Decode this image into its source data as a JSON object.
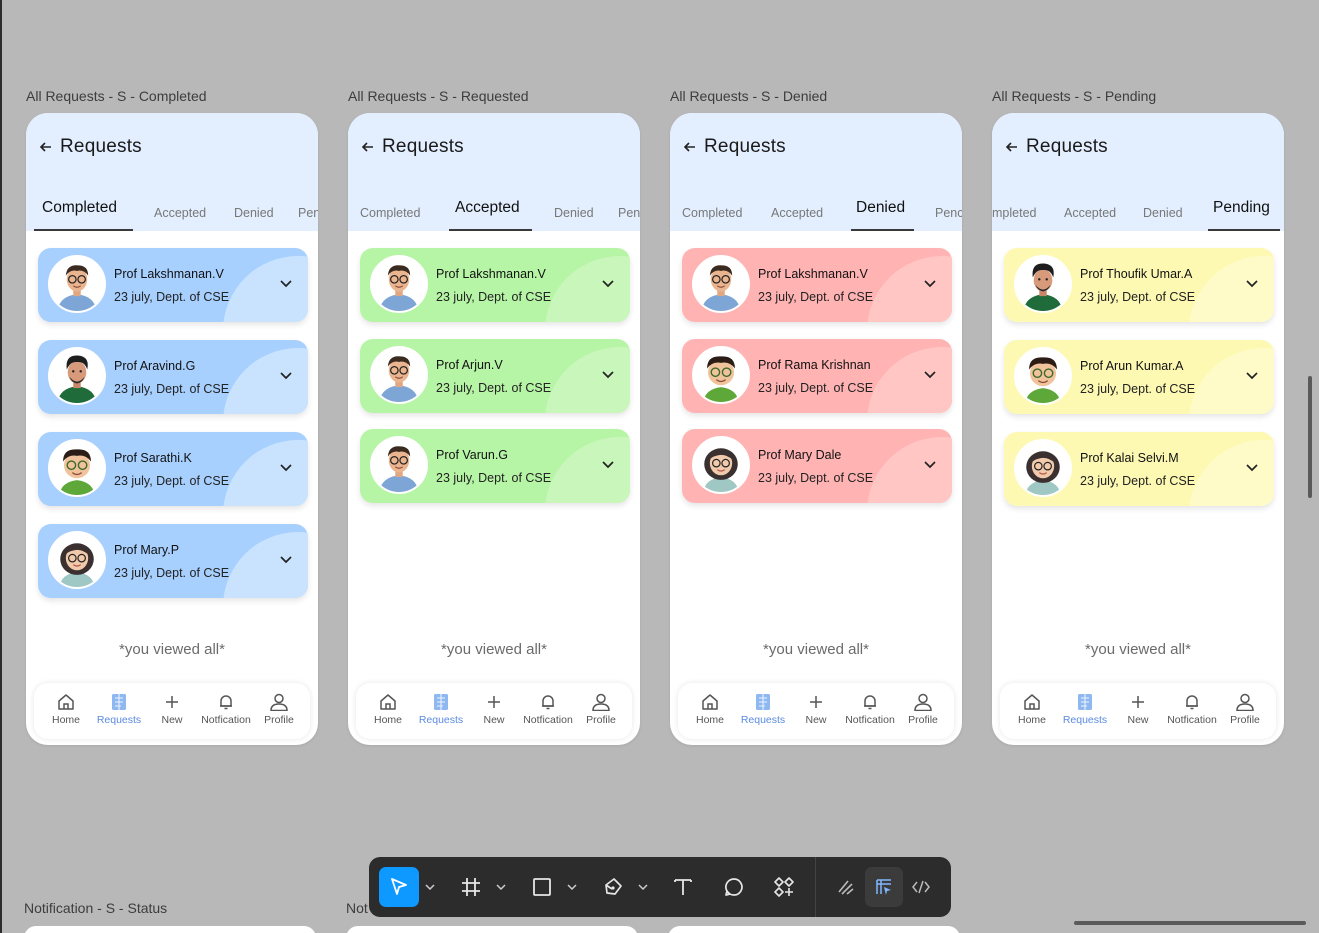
{
  "frames": [
    {
      "label": "All Requests - S - Completed",
      "title": "Requests",
      "tabs": [
        "Completed",
        "Accepted",
        "Denied",
        "Pen"
      ],
      "active_tab": 0,
      "card_color": "#a7d0ff",
      "card_arc_color": "#c9e3ff",
      "cards": [
        {
          "name": "Prof Lakshmanan.V",
          "date": "23 july, Dept. of CSE",
          "avatar": "man-glasses-avatar"
        },
        {
          "name": "Prof Aravind.G",
          "date": "23 july, Dept. of CSE",
          "avatar": "man-green-shirt-avatar"
        },
        {
          "name": "Prof Sarathi.K",
          "date": "23 july, Dept. of CSE",
          "avatar": "boy-glasses-avatar"
        },
        {
          "name": "Prof Mary.P",
          "date": "23 july, Dept. of CSE",
          "avatar": "woman-glasses-avatar"
        }
      ],
      "footer": "*you viewed all*"
    },
    {
      "label": "All Requests - S - Requested",
      "title": "Requests",
      "tabs": [
        "Completed",
        "Accepted",
        "Denied",
        "Pen"
      ],
      "active_tab": 1,
      "card_color": "#b7f5a6",
      "card_arc_color": "#c9f7bb",
      "cards": [
        {
          "name": "Prof Lakshmanan.V",
          "date": "23 july, Dept. of CSE",
          "avatar": "man-glasses-avatar"
        },
        {
          "name": "Prof Arjun.V",
          "date": "23 july, Dept. of CSE",
          "avatar": "man-glasses-avatar"
        },
        {
          "name": "Prof Varun.G",
          "date": "23 july, Dept. of CSE",
          "avatar": "man-glasses-avatar"
        }
      ],
      "footer": "*you viewed all*"
    },
    {
      "label": "All Requests - S - Denied",
      "title": "Requests",
      "tabs": [
        "Completed",
        "Accepted",
        "Denied",
        "Penc"
      ],
      "active_tab": 2,
      "card_color": "#ffb3b3",
      "card_arc_color": "#ffc6c4",
      "cards": [
        {
          "name": "Prof Lakshmanan.V",
          "date": "23 july, Dept. of CSE",
          "avatar": "man-glasses-avatar"
        },
        {
          "name": "Prof Rama Krishnan",
          "date": "23 july, Dept. of CSE",
          "avatar": "boy-glasses-avatar"
        },
        {
          "name": "Prof Mary Dale",
          "date": "23 july, Dept. of CSE",
          "avatar": "woman-glasses-avatar"
        }
      ],
      "footer": "*you viewed all*"
    },
    {
      "label": "All Requests - S - Pending",
      "title": "Requests",
      "tabs": [
        "mpleted",
        "Accepted",
        "Denied",
        "Pending"
      ],
      "active_tab": 3,
      "card_color": "#fdf9b3",
      "card_arc_color": "#fefbc8",
      "cards": [
        {
          "name": "Prof Thoufik Umar.A",
          "date": "23 july, Dept. of CSE",
          "avatar": "man-green-shirt-avatar"
        },
        {
          "name": "Prof Arun Kumar.A",
          "date": "23 july, Dept. of CSE",
          "avatar": "boy-glasses-avatar"
        },
        {
          "name": "Prof Kalai Selvi.M",
          "date": "23 july, Dept. of CSE",
          "avatar": "woman-glasses-avatar"
        }
      ],
      "footer": "*you viewed all*"
    }
  ],
  "bottom_nav": [
    {
      "label": "Home",
      "icon": "home-icon"
    },
    {
      "label": "Requests",
      "icon": "requests-icon"
    },
    {
      "label": "New",
      "icon": "plus-icon"
    },
    {
      "label": "Notfication",
      "icon": "bell-icon"
    },
    {
      "label": "Profile",
      "icon": "profile-icon"
    }
  ],
  "active_nav": 1,
  "toolbar_tools": [
    "move-tool-icon",
    "frame-tool-icon",
    "rectangle-tool-icon",
    "pen-tool-icon",
    "text-tool-icon",
    "comment-tool-icon",
    "components-icon",
    "draw-mode-icon",
    "design-mode-icon",
    "dev-mode-icon"
  ],
  "accent_color": "#0d99ff",
  "bottom_labels": [
    "Notification - S - Status",
    "Not"
  ]
}
